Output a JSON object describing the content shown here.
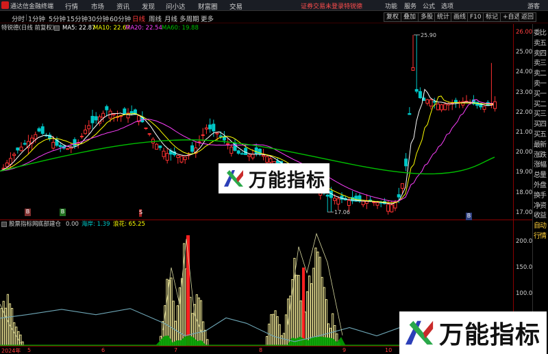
{
  "app": {
    "name": "通达信金融终端"
  },
  "menu": {
    "items": [
      "行情",
      "市场",
      "资讯",
      "发现",
      "问小达",
      "财富圈",
      "交易"
    ],
    "login": "证券交易未登录",
    "login2": "特锐德",
    "right": [
      "功能",
      "服务",
      "公式",
      "选项",
      "游客"
    ]
  },
  "toolbar": {
    "periods": [
      "分时",
      "1分钟",
      "5分钟",
      "15分钟",
      "30分钟",
      "60分钟",
      "日线",
      "周线",
      "月线",
      "多周期",
      "更多"
    ],
    "selected": "日线",
    "right": [
      "复权",
      "叠加",
      "多股",
      "统计",
      "画线",
      "F10",
      "标记",
      "+自选",
      "返回"
    ]
  },
  "info": {
    "title": "特锐德(日线 前复权)",
    "ma5": "MA5: 22.87",
    "ma10": "MA10: 22.67",
    "ma20": "MA20: 22.54",
    "ma60": "MA60: 19.88"
  },
  "price_axis": {
    "ticks": [
      "26.00",
      "25.00",
      "24.00",
      "23.00",
      "22.00",
      "21.00",
      "20.00",
      "19.00",
      "18.00",
      "17.00"
    ],
    "high_label": "25.90",
    "low_label": "17.06"
  },
  "sub": {
    "title": "股票指标网",
    "name": "底部建仓",
    "value": "0.00",
    "hy_label": "海岸: 1.39",
    "lh_label": "浪花: 65.25",
    "ticks": [
      "200.0",
      "150.0",
      "100.0",
      "50.0"
    ]
  },
  "xaxis": {
    "labels": [
      "2024年",
      "5",
      "6",
      "7",
      "8",
      "9",
      "10"
    ]
  },
  "right_panel": {
    "top": "R",
    "top2": "500",
    "items": [
      "委比",
      "卖五",
      "卖四",
      "卖三",
      "卖二",
      "卖一",
      "买一",
      "买二",
      "买三",
      "买四",
      "买五",
      "最新",
      "涨跌",
      "涨幅",
      "总量",
      "外盘",
      "换手",
      "净资",
      "收益",
      "自动",
      "行情"
    ]
  },
  "markers": [
    "B",
    "B",
    "S",
    "B"
  ],
  "watermark": {
    "text": "万能指标"
  },
  "colors": {
    "up": "#ff3232",
    "down": "#00c8c8",
    "ma5": "#ffffff",
    "ma10": "#ffff00",
    "ma20": "#ff40ff",
    "ma60": "#00c000",
    "bars": "#e8e090",
    "sea": "#6fa8b8",
    "redbar": "#ff2020",
    "grass": "#00a000"
  }
}
